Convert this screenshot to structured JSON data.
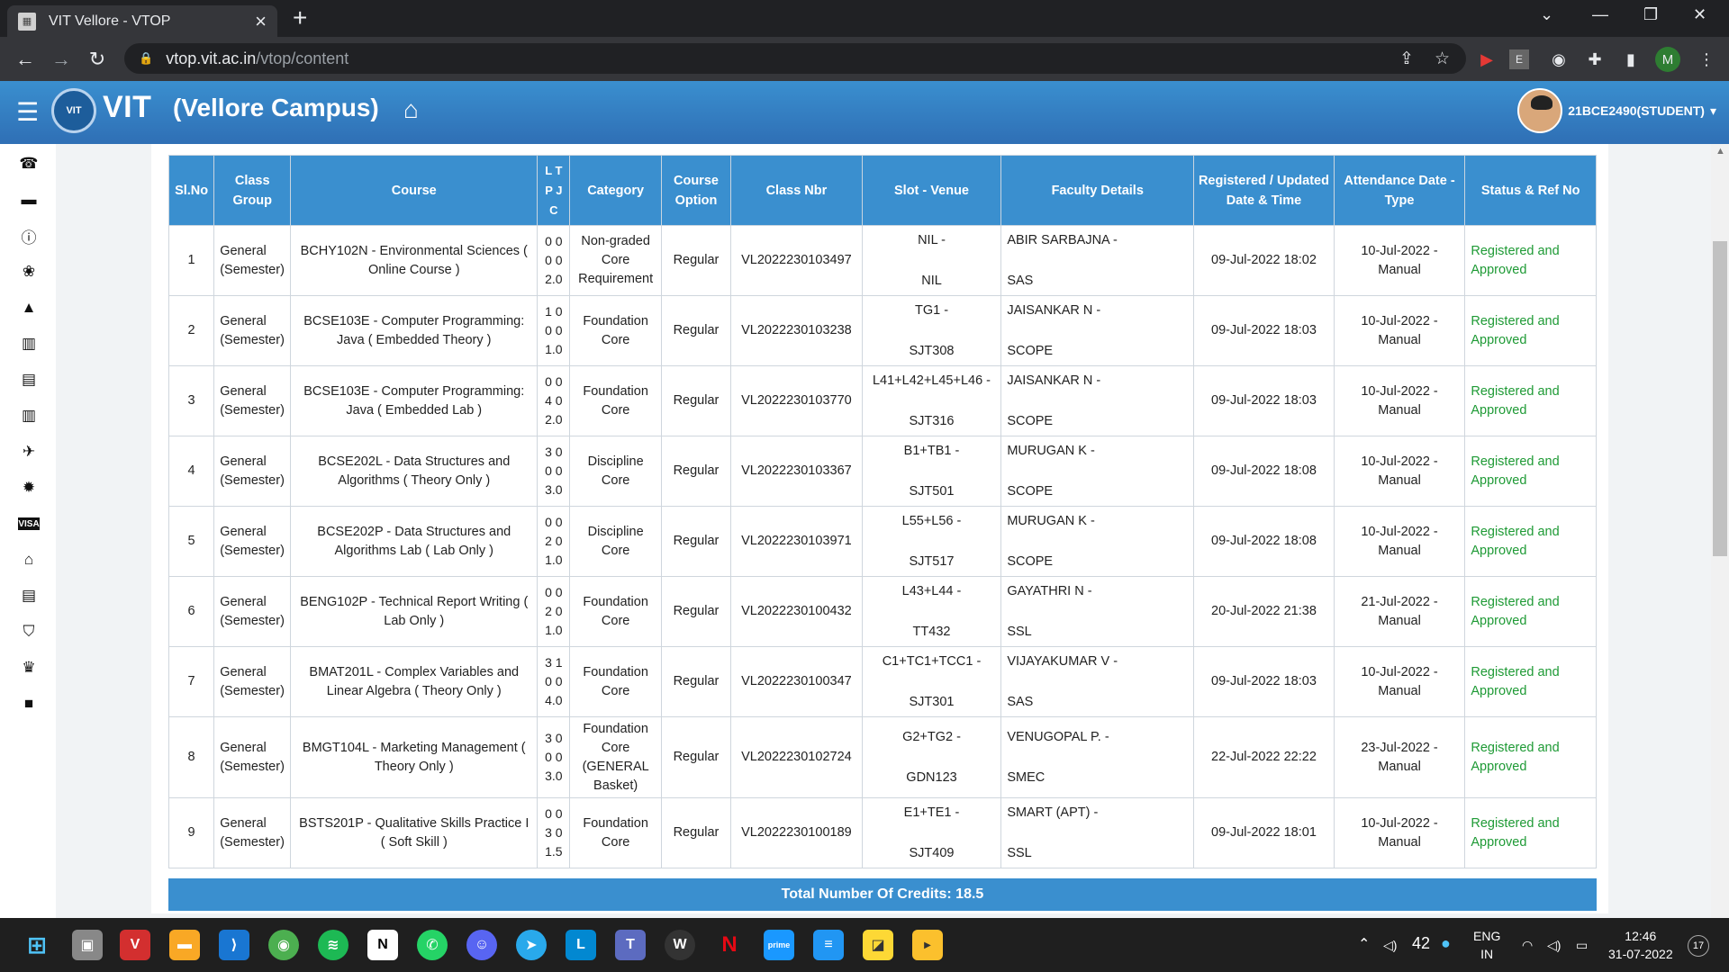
{
  "browser": {
    "tab_title": "VIT Vellore - VTOP",
    "url_host": "vtop.vit.ac.in",
    "url_path": "/vtop/content",
    "profile_initial": "M"
  },
  "header": {
    "brand": "VIT",
    "campus": "(Vellore Campus)",
    "user": "21BCE2490(STUDENT)"
  },
  "table": {
    "headers": [
      "Sl.No",
      "Class Group",
      "Course",
      "L T P J C",
      "Category",
      "Course Option",
      "Class Nbr",
      "Slot - Venue",
      "Faculty Details",
      "Registered / Updated Date & Time",
      "Attendance Date - Type",
      "Status & Ref No"
    ],
    "rows": [
      {
        "sl": "1",
        "group": "General (Semester)",
        "course": "BCHY102N - Environmental Sciences ( Online Course )",
        "ltpc": "0 0\n0 0\n2.0",
        "category": "Non-graded Core Requirement",
        "option": "Regular",
        "nbr": "VL2022230103497",
        "slot": "NIL -",
        "venue": "NIL",
        "faculty": "ABIR SARBAJNA -",
        "school": "SAS",
        "reg": "09-Jul-2022 18:02",
        "att": "10-Jul-2022 - Manual",
        "status": "Registered and Approved"
      },
      {
        "sl": "2",
        "group": "General (Semester)",
        "course": "BCSE103E - Computer Programming: Java ( Embedded Theory )",
        "ltpc": "1 0\n0 0\n1.0",
        "category": "Foundation Core",
        "option": "Regular",
        "nbr": "VL2022230103238",
        "slot": "TG1 -",
        "venue": "SJT308",
        "faculty": "JAISANKAR N -",
        "school": "SCOPE",
        "reg": "09-Jul-2022 18:03",
        "att": "10-Jul-2022 - Manual",
        "status": "Registered and Approved"
      },
      {
        "sl": "3",
        "group": "General (Semester)",
        "course": "BCSE103E - Computer Programming: Java ( Embedded Lab )",
        "ltpc": "0 0\n4 0\n2.0",
        "category": "Foundation Core",
        "option": "Regular",
        "nbr": "VL2022230103770",
        "slot": "L41+L42+L45+L46 -",
        "venue": "SJT316",
        "faculty": "JAISANKAR N -",
        "school": "SCOPE",
        "reg": "09-Jul-2022 18:03",
        "att": "10-Jul-2022 - Manual",
        "status": "Registered and Approved"
      },
      {
        "sl": "4",
        "group": "General (Semester)",
        "course": "BCSE202L - Data Structures and Algorithms ( Theory Only )",
        "ltpc": "3 0\n0 0\n3.0",
        "category": "Discipline Core",
        "option": "Regular",
        "nbr": "VL2022230103367",
        "slot": "B1+TB1 -",
        "venue": "SJT501",
        "faculty": "MURUGAN K -",
        "school": "SCOPE",
        "reg": "09-Jul-2022 18:08",
        "att": "10-Jul-2022 - Manual",
        "status": "Registered and Approved"
      },
      {
        "sl": "5",
        "group": "General (Semester)",
        "course": "BCSE202P - Data Structures and Algorithms Lab ( Lab Only )",
        "ltpc": "0 0\n2 0\n1.0",
        "category": "Discipline Core",
        "option": "Regular",
        "nbr": "VL2022230103971",
        "slot": "L55+L56 -",
        "venue": "SJT517",
        "faculty": "MURUGAN K -",
        "school": "SCOPE",
        "reg": "09-Jul-2022 18:08",
        "att": "10-Jul-2022 - Manual",
        "status": "Registered and Approved"
      },
      {
        "sl": "6",
        "group": "General (Semester)",
        "course": "BENG102P - Technical Report Writing ( Lab Only )",
        "ltpc": "0 0\n2 0\n1.0",
        "category": "Foundation Core",
        "option": "Regular",
        "nbr": "VL2022230100432",
        "slot": "L43+L44 -",
        "venue": "TT432",
        "faculty": "GAYATHRI N -",
        "school": "SSL",
        "reg": "20-Jul-2022 21:38",
        "att": "21-Jul-2022 - Manual",
        "status": "Registered and Approved"
      },
      {
        "sl": "7",
        "group": "General (Semester)",
        "course": "BMAT201L - Complex Variables and Linear Algebra ( Theory Only )",
        "ltpc": "3 1\n0 0\n4.0",
        "category": "Foundation Core",
        "option": "Regular",
        "nbr": "VL2022230100347",
        "slot": "C1+TC1+TCC1 -",
        "venue": "SJT301",
        "faculty": "VIJAYAKUMAR V -",
        "school": "SAS",
        "reg": "09-Jul-2022 18:03",
        "att": "10-Jul-2022 - Manual",
        "status": "Registered and Approved"
      },
      {
        "sl": "8",
        "group": "General (Semester)",
        "course": "BMGT104L - Marketing Management ( Theory Only )",
        "ltpc": "3 0\n0 0\n3.0",
        "category": "Foundation Core (GENERAL Basket)",
        "option": "Regular",
        "nbr": "VL2022230102724",
        "slot": "G2+TG2 -",
        "venue": "GDN123",
        "faculty": "VENUGOPAL P. -",
        "school": "SMEC",
        "reg": "22-Jul-2022 22:22",
        "att": "23-Jul-2022 - Manual",
        "status": "Registered and Approved"
      },
      {
        "sl": "9",
        "group": "General (Semester)",
        "course": "BSTS201P - Qualitative Skills Practice I ( Soft Skill )",
        "ltpc": "0 0\n3 0\n1.5",
        "category": "Foundation Core",
        "option": "Regular",
        "nbr": "VL2022230100189",
        "slot": "E1+TE1 -",
        "venue": "SJT409",
        "faculty": "SMART (APT) -",
        "school": "SSL",
        "reg": "09-Jul-2022 18:01",
        "att": "10-Jul-2022 - Manual",
        "status": "Registered and Approved"
      }
    ],
    "total_label": "Total Number Of Credits: 18.5"
  },
  "taskbar": {
    "temp": "42",
    "lang1": "ENG",
    "lang2": "IN",
    "time": "12:46",
    "date": "31-07-2022",
    "notif": "17"
  },
  "colors": {
    "accent": "#3a8fcf",
    "status": "#1e9a35"
  }
}
